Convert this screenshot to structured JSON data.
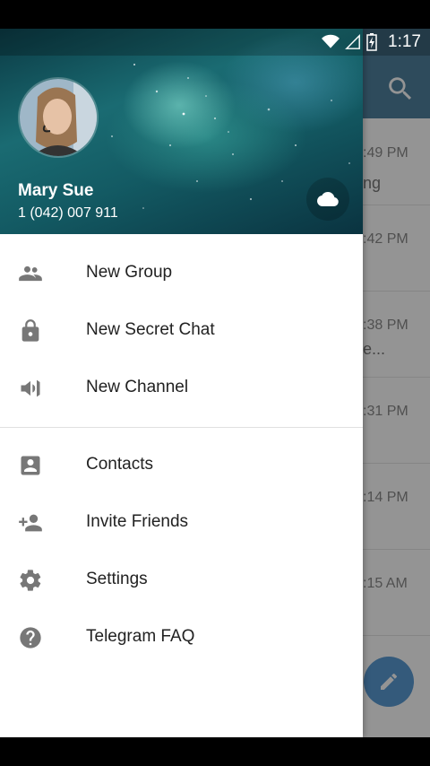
{
  "status_bar": {
    "time": "1:17"
  },
  "header": {
    "user_name": "Mary Sue",
    "phone": "1 (042) 007 911",
    "icons": {
      "avatar": "user-avatar",
      "cloud": "cloud-icon"
    }
  },
  "menu": {
    "group1": [
      {
        "label": "New Group",
        "icon": "group-icon"
      },
      {
        "label": "New Secret Chat",
        "icon": "lock-icon"
      },
      {
        "label": "New Channel",
        "icon": "megaphone-icon"
      }
    ],
    "group2": [
      {
        "label": "Contacts",
        "icon": "contact-card-icon"
      },
      {
        "label": "Invite Friends",
        "icon": "add-person-icon"
      },
      {
        "label": "Settings",
        "icon": "gear-icon"
      },
      {
        "label": "Telegram FAQ",
        "icon": "help-icon"
      }
    ]
  },
  "background_chats": [
    {
      "time": ":49 PM",
      "snippet": "ng"
    },
    {
      "time": ":42 PM",
      "snippet": ""
    },
    {
      "time": ":38 PM",
      "snippet": "e..."
    },
    {
      "time": ":31 PM",
      "snippet": ""
    },
    {
      "time": ":14 PM",
      "snippet": ""
    },
    {
      "time": ":15 AM",
      "snippet": ""
    }
  ],
  "colors": {
    "app_bar": "#50829f",
    "fab": "#5a9bd5",
    "icon_gray": "#777777"
  }
}
